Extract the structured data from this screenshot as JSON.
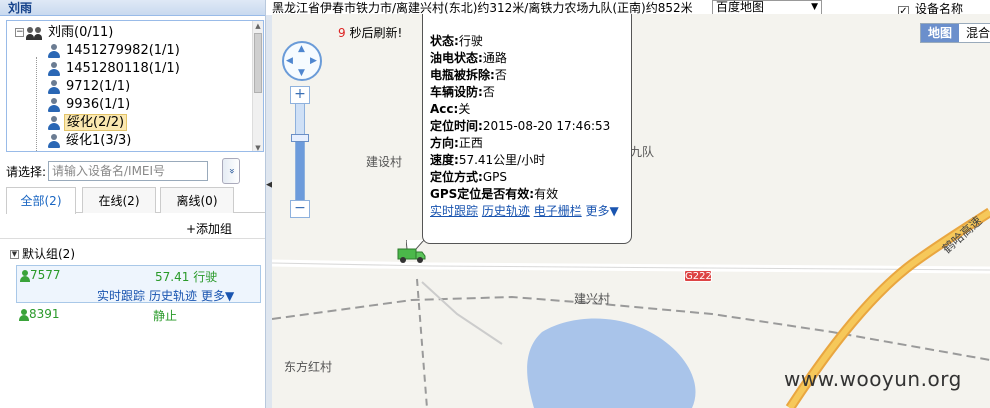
{
  "left_panel": {
    "title": "刘雨",
    "tree": {
      "root": "刘雨(0/11)",
      "children": [
        {
          "label": "1451279982(1/1)",
          "selected": false
        },
        {
          "label": "1451280118(1/1)",
          "selected": false
        },
        {
          "label": "9712(1/1)",
          "selected": false
        },
        {
          "label": "9936(1/1)",
          "selected": false
        },
        {
          "label": "绥化(2/2)",
          "selected": true
        },
        {
          "label": "绥化1(3/3)",
          "selected": false
        }
      ]
    },
    "select_label": "请选择:",
    "search_placeholder": "请输入设备名/IMEI号",
    "dropdown_glyph": "»",
    "tabs": [
      {
        "label": "全部(2)",
        "active": true
      },
      {
        "label": "在线(2)",
        "active": false
      },
      {
        "label": "离线(0)",
        "active": false
      }
    ],
    "add_group": "+添加组",
    "group": {
      "label": "默认组(2)",
      "devices": [
        {
          "name": "7577",
          "speed": "57.41",
          "status": "行驶",
          "links": [
            "实时跟踪",
            "历史轨迹",
            "更多▼"
          ]
        },
        {
          "name": "8391",
          "status": "静止"
        }
      ]
    }
  },
  "top_bar": {
    "address": "黑龙江省伊春市铁力市/离建兴村(东北)约312米/离铁力农场九队(正南)约852米",
    "map_type_select": "百度地图",
    "device_name_checkbox": "设备名称",
    "device_name_checked": true
  },
  "map": {
    "refresh_seconds": "9",
    "refresh_text": " 秒后刷新!",
    "map_tabs": [
      {
        "label": "地图",
        "active": true
      },
      {
        "label": "混合",
        "active": false
      }
    ],
    "popup": {
      "rows": [
        {
          "k": "状态:",
          "v": "行驶"
        },
        {
          "k": "油电状态:",
          "v": "通路"
        },
        {
          "k": "电瓶被拆除:",
          "v": "否"
        },
        {
          "k": "车辆设防:",
          "v": "否"
        },
        {
          "k": "Acc:",
          "v": "关"
        },
        {
          "k": "定位时间:",
          "v": "2015-08-20 17:46:53"
        },
        {
          "k": "方向:",
          "v": "正西"
        },
        {
          "k": "速度:",
          "v": "57.41公里/小时"
        },
        {
          "k": "定位方式:",
          "v": "GPS"
        },
        {
          "k": "GPS定位是否有效:",
          "v": "有效"
        }
      ],
      "links": [
        "实时跟踪",
        "历史轨迹",
        "电子栅栏",
        "更多▼"
      ]
    },
    "labels": {
      "village1": "建设村",
      "village2": "建兴村",
      "village3": "东方红村",
      "team": "九队",
      "highway": "鹤哈高速",
      "road": "G222"
    },
    "watermark": "www.wooyun.org",
    "colors": {
      "highway": "#f3b13c",
      "lake": "#a9c4ea",
      "road": "#ffffff",
      "rail": "#9a9a9a"
    }
  }
}
